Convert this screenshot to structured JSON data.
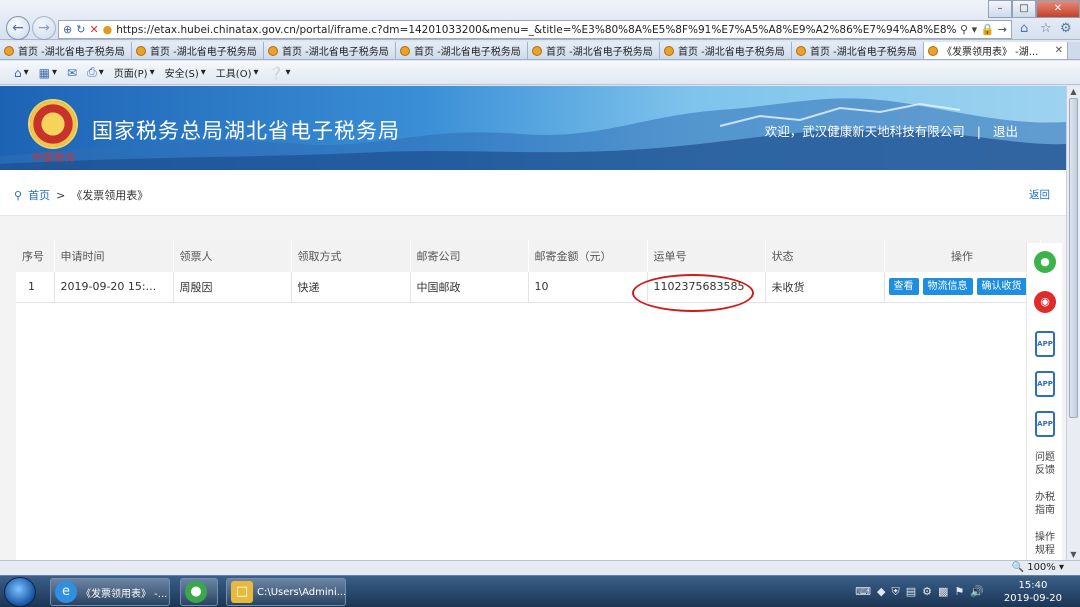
{
  "browser": {
    "url": "https://etax.hubei.chinatax.gov.cn/portal/iframe.c?dm=14201033200&menu=_&title=%E3%80%8A%E5%8F%91%E7%A5%A8%E9%A2%86%E7%94%A8%E8%A1%A8%E3%80%8B&gc",
    "tabs": [
      "首页 -湖北省电子税务局",
      "首页 -湖北省电子税务局",
      "首页 -湖北省电子税务局",
      "首页 -湖北省电子税务局",
      "首页 -湖北省电子税务局",
      "首页 -湖北省电子税务局",
      "首页 -湖北省电子税务局",
      "《发票领用表》 -湖..."
    ],
    "commands": [
      "页面(P)",
      "安全(S)",
      "工具(O)"
    ],
    "zoom": "100%"
  },
  "header": {
    "site_title": "国家税务总局湖北省电子税务局",
    "emblem_text": "中国税务",
    "welcome": "欢迎，武汉健康新天地科技有限公司",
    "separator": "|",
    "logout": "退出"
  },
  "breadcrumb": {
    "home": "首页",
    "arrow": ">",
    "current": "《发票领用表》",
    "back": "返回"
  },
  "table": {
    "columns": [
      "序号",
      "申请时间",
      "领票人",
      "领取方式",
      "邮寄公司",
      "邮寄金额（元）",
      "运单号",
      "状态",
      "操作"
    ],
    "rows": [
      {
        "index": "1",
        "time": "2019-09-20 15:...",
        "person": "周殷因",
        "method": "快递",
        "company": "中国邮政",
        "amount": "10",
        "waybill": "1102375683585",
        "status": "未收货",
        "actions": [
          "查看",
          "物流信息",
          "确认收货"
        ]
      }
    ]
  },
  "side": {
    "app1": "APP",
    "app2": "APP",
    "app3": "APP",
    "faq": "问题反馈",
    "guide": "办税指南",
    "rules": "操作规程"
  },
  "taskbar": {
    "ie_task": "《发票领用表》 -...",
    "explorer_task": "C:\\Users\\Admini...",
    "time": "15:40",
    "date": "2019-09-20"
  },
  "colors": {
    "accent": "#1f8ee0",
    "highlight": "#d21a1a"
  }
}
